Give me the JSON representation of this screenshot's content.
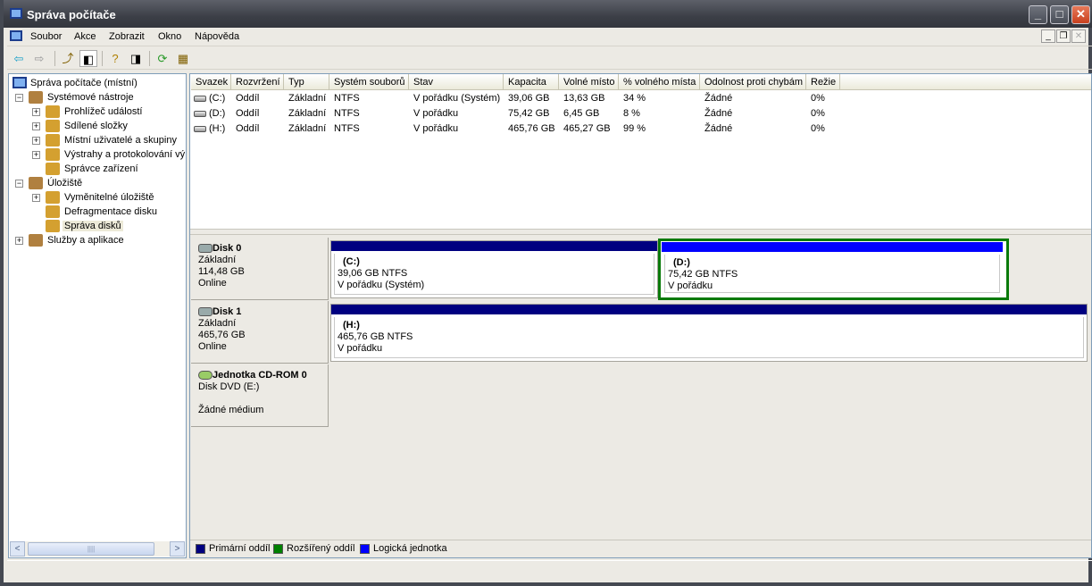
{
  "window": {
    "title": "Správa počítače"
  },
  "menu": [
    "Soubor",
    "Akce",
    "Zobrazit",
    "Okno",
    "Nápověda"
  ],
  "tree": {
    "root": "Správa počítače (místní)",
    "items": [
      {
        "label": "Systémové nástroje",
        "level": 1,
        "expander": "−"
      },
      {
        "label": "Prohlížeč událostí",
        "level": 2,
        "expander": "+"
      },
      {
        "label": "Sdílené složky",
        "level": 2,
        "expander": "+"
      },
      {
        "label": "Místní uživatelé a skupiny",
        "level": 2,
        "expander": "+"
      },
      {
        "label": "Výstrahy a protokolování vý",
        "level": 2,
        "expander": "+"
      },
      {
        "label": "Správce zařízení",
        "level": 2,
        "expander": ""
      },
      {
        "label": "Úložiště",
        "level": 1,
        "expander": "−"
      },
      {
        "label": "Vyměnitelné úložiště",
        "level": 2,
        "expander": "+"
      },
      {
        "label": "Defragmentace disku",
        "level": 2,
        "expander": ""
      },
      {
        "label": "Správa disků",
        "level": 2,
        "expander": "",
        "selected": true
      },
      {
        "label": "Služby a aplikace",
        "level": 1,
        "expander": "+"
      }
    ]
  },
  "table": {
    "columns": [
      "Svazek",
      "Rozvržení",
      "Typ",
      "Systém souborů",
      "Stav",
      "Kapacita",
      "Volné místo",
      "% volného místa",
      "Odolnost proti chybám",
      "Režie"
    ],
    "rows": [
      [
        "(C:)",
        "Oddíl",
        "Základní",
        "NTFS",
        "V pořádku (Systém)",
        "39,06 GB",
        "13,63 GB",
        "34 %",
        "Žádné",
        "0%"
      ],
      [
        "(D:)",
        "Oddíl",
        "Základní",
        "NTFS",
        "V pořádku",
        "75,42 GB",
        "6,45 GB",
        "8 %",
        "Žádné",
        "0%"
      ],
      [
        "(H:)",
        "Oddíl",
        "Základní",
        "NTFS",
        "V pořádku",
        "465,76 GB",
        "465,27 GB",
        "99 %",
        "Žádné",
        "0%"
      ]
    ]
  },
  "disks": [
    {
      "name": "Disk 0",
      "type": "Základní",
      "size": "114,48 GB",
      "status": "Online",
      "partitions": [
        {
          "letter": "(C:)",
          "size": "39,06 GB NTFS",
          "status": "V pořádku (Systém)",
          "kind": "primary"
        },
        {
          "letter": "(D:)",
          "size": "75,42 GB NTFS",
          "status": "V pořádku",
          "kind": "logical"
        }
      ]
    },
    {
      "name": "Disk 1",
      "type": "Základní",
      "size": "465,76 GB",
      "status": "Online",
      "partitions": [
        {
          "letter": "(H:)",
          "size": "465,76 GB NTFS",
          "status": "V pořádku",
          "kind": "primary"
        }
      ]
    },
    {
      "name": "Jednotka CD-ROM 0",
      "type": "Disk DVD (E:)",
      "status": "Žádné médium"
    }
  ],
  "legend": [
    {
      "label": "Primární oddíl",
      "color": "#000080"
    },
    {
      "label": "Rozšířený oddíl",
      "color": "#008000"
    },
    {
      "label": "Logická jednotka",
      "color": "#0000ff"
    }
  ]
}
